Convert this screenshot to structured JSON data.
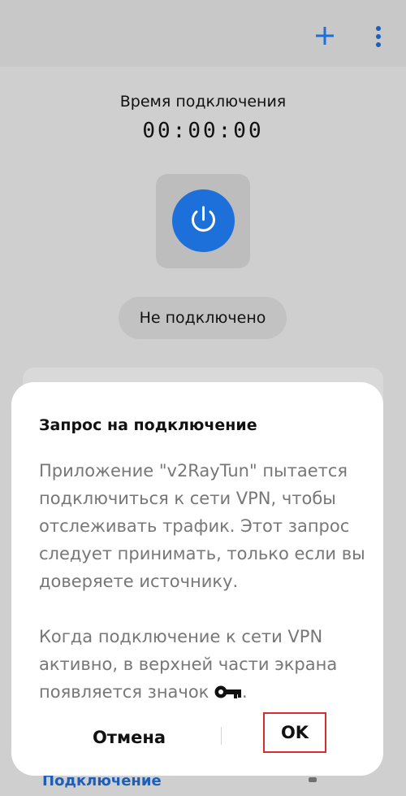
{
  "appbar": {
    "add_icon": "plus-icon",
    "menu_icon": "more-vert-icon",
    "accent": "#1d6fd9"
  },
  "main": {
    "time_label": "Время подключения",
    "timer": "00:00:00",
    "power_icon": "power-icon",
    "status": "Не подключено",
    "bottom_tab": "Подключение"
  },
  "dialog": {
    "title": "Запрос на подключение",
    "body_1": "Приложение \"v2RayTun\" пытается подключиться к сети VPN, чтобы отслеживать трафик. Этот запрос следует принимать, только если вы доверяете источнику.",
    "body_2": "Когда подключение к сети VPN активно, в верхней части экрана появляется значок",
    "body_2_end": ".",
    "key_icon": "key-icon",
    "cancel_label": "Отмена",
    "ok_label": "OK"
  }
}
